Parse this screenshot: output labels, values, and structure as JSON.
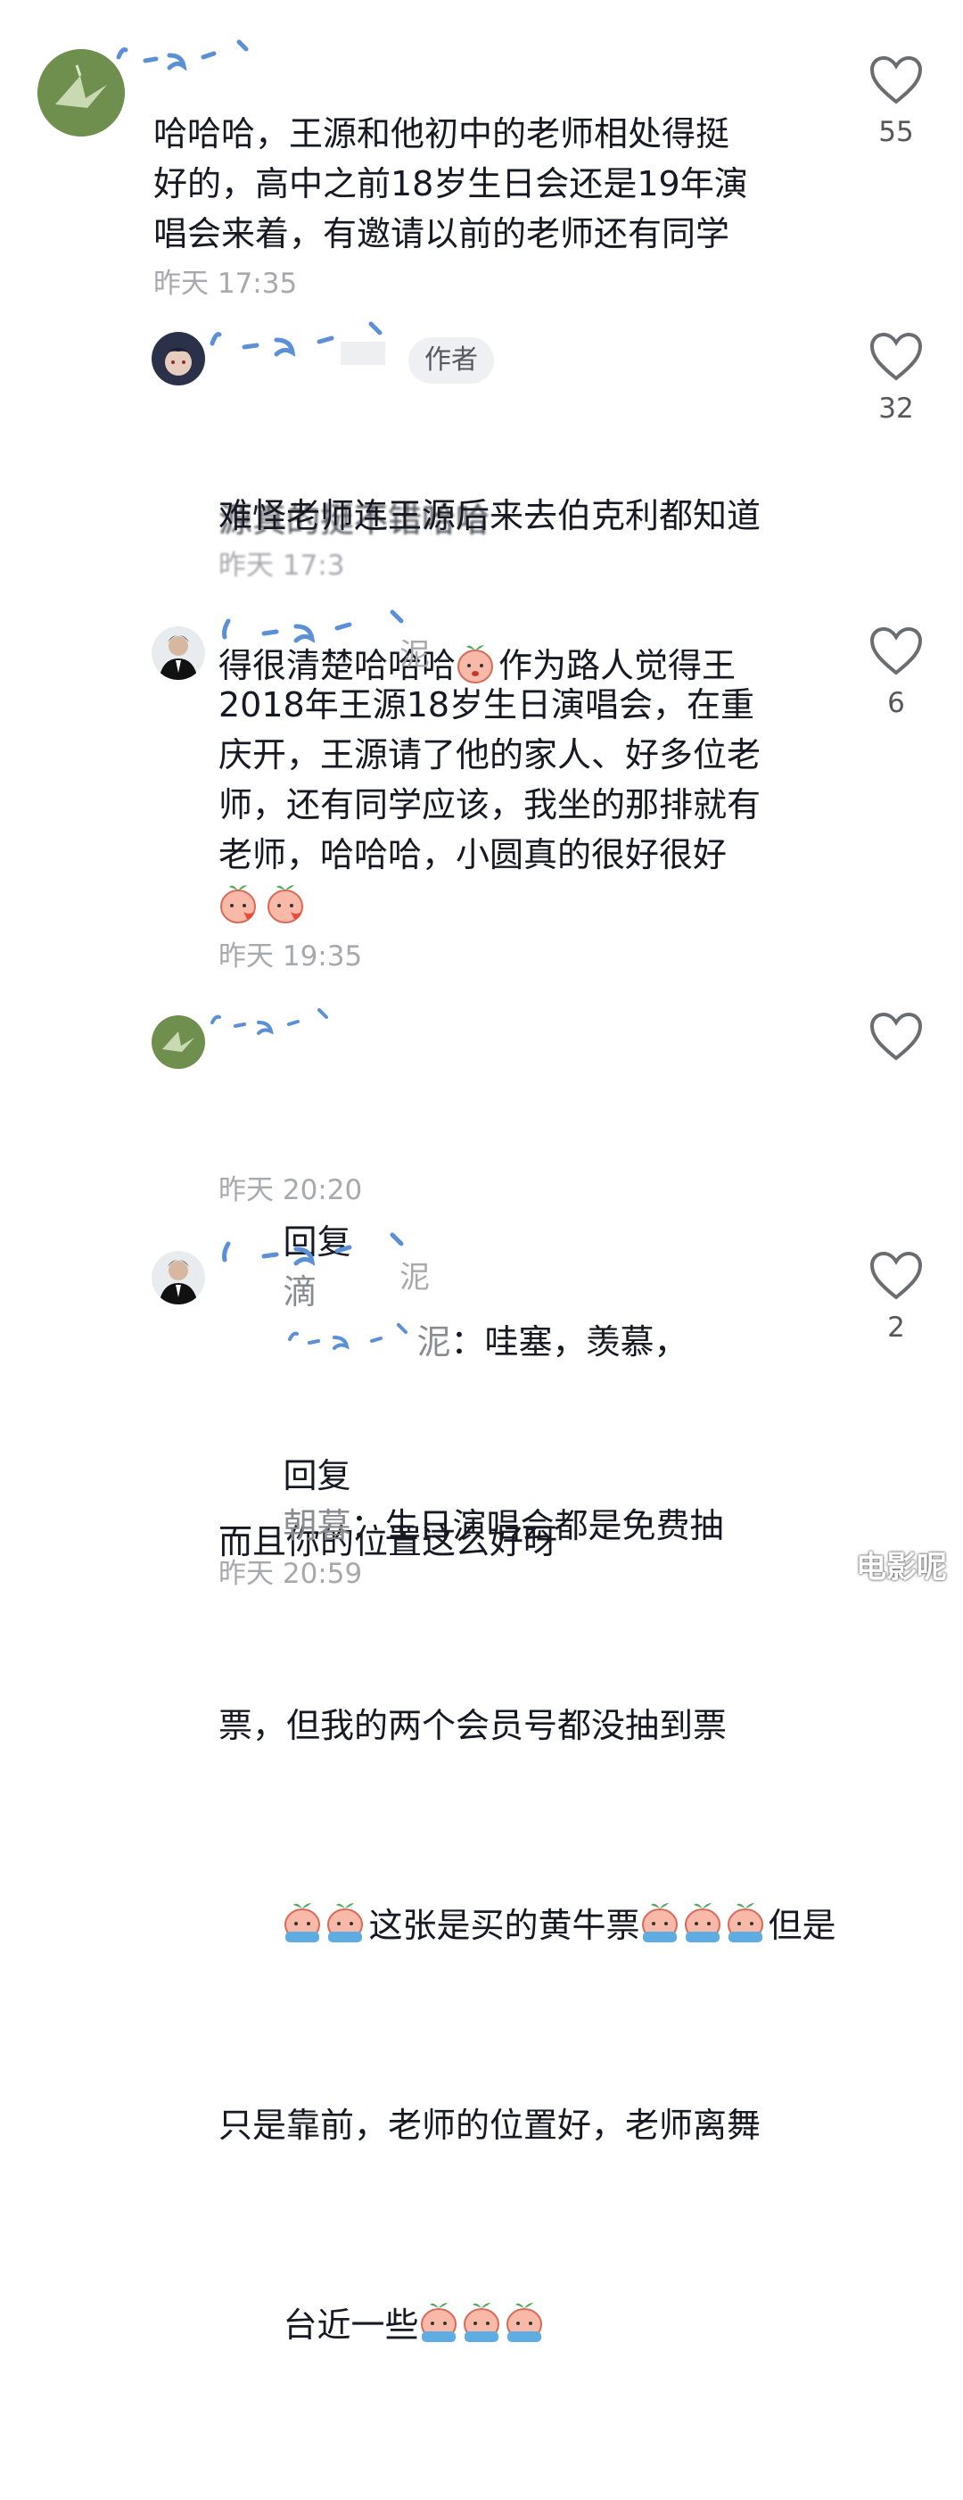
{
  "comments": [
    {
      "name_fragment": "",
      "text": "哈哈哈，王源和他初中的老师相处得挺\n好的，高中之前18岁生日会还是19年演\n唱会来着，有邀请以前的老师还有同学",
      "time": "昨天 17:35",
      "likes": "55",
      "avatar": "paper-crane-avatar"
    },
    {
      "name_fragment": "",
      "author_tag": "作者",
      "text_line1": "难怪老师连王源后来去伯克利都知道",
      "text_line2a": "得很清楚哈哈哈",
      "text_line2b": "作为路人觉得王",
      "text_line3": "源真的挺不错哈哈",
      "time": "昨天 17:3",
      "likes": "32",
      "avatar": "anime-character-avatar"
    },
    {
      "name_fragment": "泥",
      "text": "2018年王源18岁生日演唱会，在重\n庆开，王源请了他的家人、好多位老\n师，还有同学应该，我坐的那排就有\n老师，哈哈哈，小圆真的很好很好",
      "time": "昨天 19:35",
      "likes": "6",
      "avatar": "suited-man-avatar"
    },
    {
      "name_fragment": "",
      "reply_prefix": "回复",
      "reply_target_a": "滴",
      "reply_target_b": "泥",
      "text_after": "：哇塞，羡慕，",
      "text_line2": "而且你的位置这么好呀",
      "time": "昨天 20:20",
      "likes": "",
      "avatar": "paper-crane-avatar"
    },
    {
      "name_fragment": "泥",
      "reply_prefix": "回复",
      "reply_target": "朝暮",
      "text_after": "：生日演唱会都是免费抽",
      "text_line2": "票，但我的两个会员号都没抽到票",
      "text_line3": "这张是买的黄牛票",
      "text_line3b": "但是",
      "text_line4": "只是靠前，老师的位置好，老师离舞",
      "text_line5": "台近一些",
      "time": "昨天 20:59",
      "likes": "2",
      "avatar": "suited-man-avatar"
    }
  ],
  "watermark": "电影呢",
  "colors": {
    "text": "#161823",
    "secondary": "#a8a9ae",
    "reply_target": "#8a8b91",
    "tag_bg": "#eef0f3"
  }
}
